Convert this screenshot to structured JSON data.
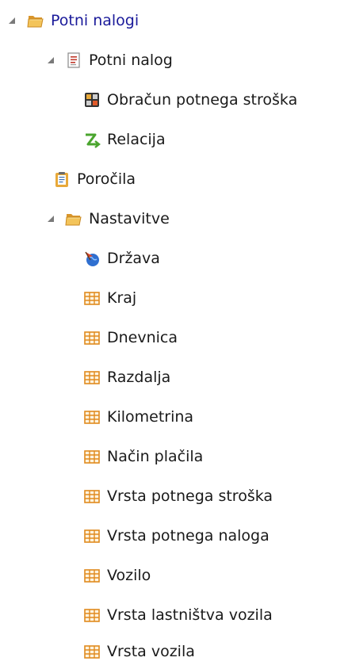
{
  "tree": {
    "root": {
      "label": "Potni nalogi",
      "icon": "folder-open-icon",
      "expanded": true,
      "children": {
        "potni_nalog": {
          "label": "Potni nalog",
          "icon": "document-icon",
          "expanded": true,
          "children": {
            "obracun": {
              "label": "Obračun potnega stroška",
              "icon": "calculator-icon"
            },
            "relacija": {
              "label": "Relacija",
              "icon": "route-arrow-icon"
            }
          }
        },
        "porocila": {
          "label": "Poročila",
          "icon": "report-clipboard-icon"
        },
        "nastavitve": {
          "label": "Nastavitve",
          "icon": "folder-open-icon",
          "expanded": true,
          "children": {
            "drzava": {
              "label": "Država",
              "icon": "globe-flag-icon"
            },
            "kraj": {
              "label": "Kraj",
              "icon": "table-icon"
            },
            "dnevnica": {
              "label": "Dnevnica",
              "icon": "table-icon"
            },
            "razdalja": {
              "label": "Razdalja",
              "icon": "table-icon"
            },
            "kilometrina": {
              "label": "Kilometrina",
              "icon": "table-icon"
            },
            "nacin_placila": {
              "label": "Način plačila",
              "icon": "table-icon"
            },
            "vrsta_potnega_stroska": {
              "label": "Vrsta potnega stroška",
              "icon": "table-icon"
            },
            "vrsta_potnega_naloga": {
              "label": "Vrsta potnega naloga",
              "icon": "table-icon"
            },
            "vozilo": {
              "label": "Vozilo",
              "icon": "table-icon"
            },
            "vrsta_lastnistva_vozila": {
              "label": "Vrsta lastništva vozila",
              "icon": "table-icon"
            },
            "vrsta_vozila": {
              "label": "Vrsta vozila",
              "icon": "table-icon"
            }
          }
        }
      }
    }
  },
  "colors": {
    "root_label": "#1a1a9a",
    "folder": "#e8a93a",
    "table_grid": "#e08a1e",
    "toggle": "#888888"
  }
}
